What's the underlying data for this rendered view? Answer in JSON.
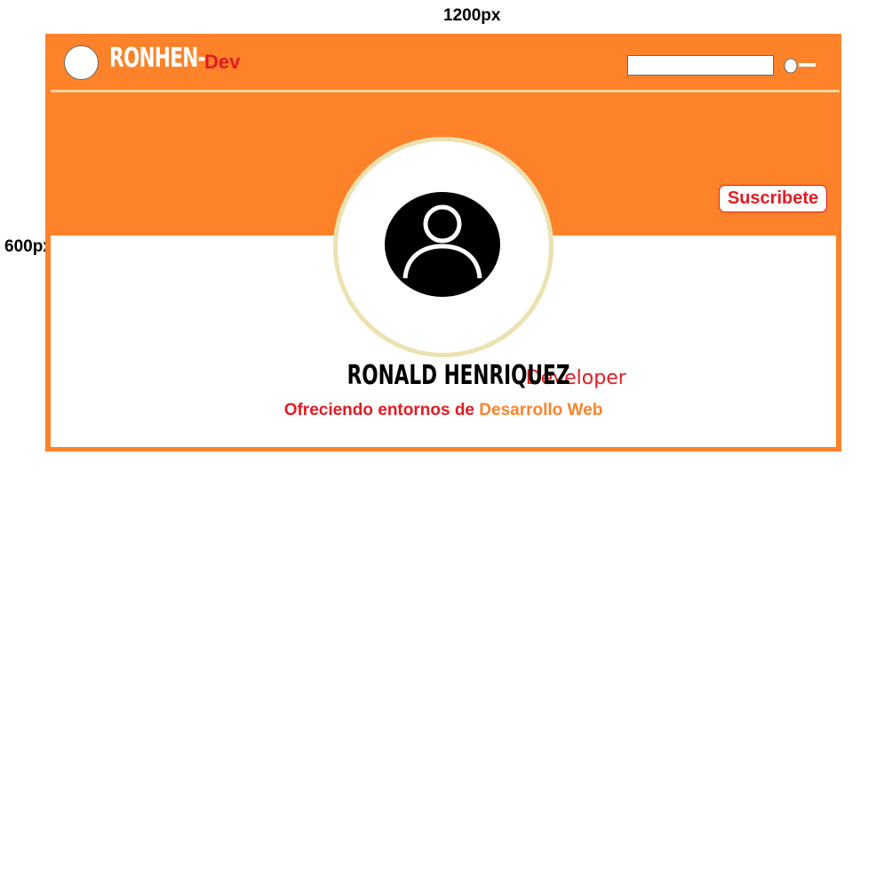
{
  "annotations": {
    "width_label": "1200px",
    "height_label": "600px"
  },
  "header": {
    "brand_main": "RONHEN-",
    "brand_suffix": "Dev",
    "search": {
      "value": "",
      "placeholder": ""
    }
  },
  "hero": {
    "subscribe_label": "Suscribete"
  },
  "profile": {
    "name": "RONALD HENRIQUEZ",
    "role": "Developer",
    "tagline_part1": "Ofreciendo entornos de ",
    "tagline_part2": "Desarrollo Web"
  },
  "colors": {
    "primary_orange": "#fe8229",
    "accent_red": "#e21b23",
    "ring_cream": "#ece1b0",
    "divider": "#fdd59a"
  },
  "icons": {
    "logo": "circle-logo-icon",
    "search": "search-icon",
    "avatar": "user-avatar-icon"
  }
}
